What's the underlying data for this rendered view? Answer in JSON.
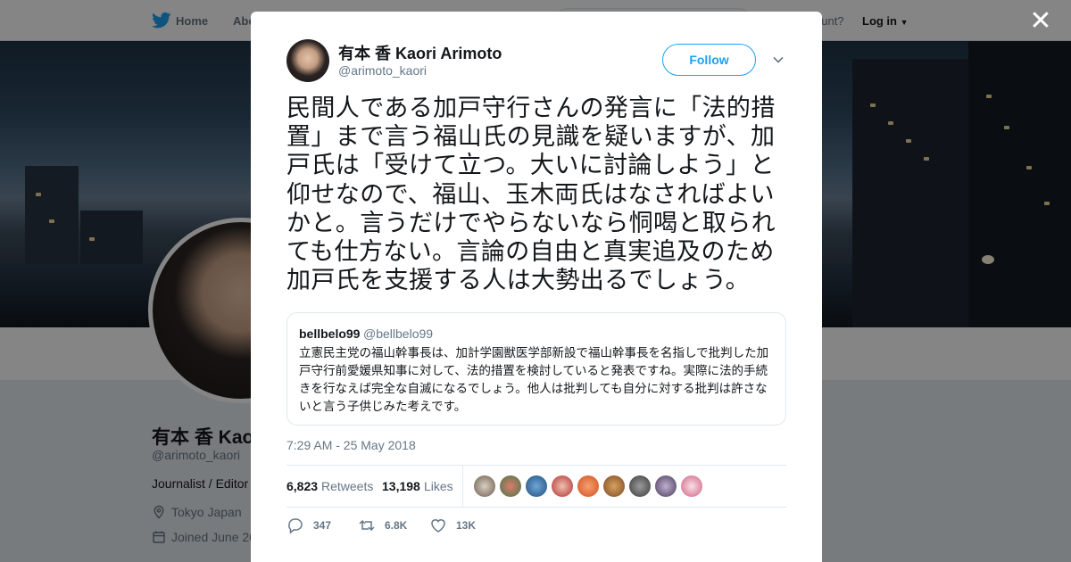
{
  "nav": {
    "home_label": "Home",
    "about_label": "Abo",
    "account_prompt": "ccount?",
    "login_label": "Log in"
  },
  "profile": {
    "name": "有本 香 Kao",
    "handle": "@arimoto_kaori",
    "bio": "Journalist / Editor",
    "location": "Tokyo Japan",
    "joined": "Joined June 20"
  },
  "tweet": {
    "author_name": "有本 香 Kaori Arimoto",
    "author_handle": "@arimoto_kaori",
    "follow_label": "Follow",
    "text": "民間人である加戸守行さんの発言に「法的措置」まで言う福山氏の見識を疑いますが、加戸氏は「受けて立つ。大いに討論しよう」と仰せなので、福山、玉木両氏はなさればよいかと。言うだけでやらないなら恫喝と取られても仕方ない。言論の自由と真実追及のため加戸氏を支援する人は大勢出るでしょう。",
    "timestamp": "7:29 AM - 25 May 2018",
    "quoted": {
      "name": "bellbelo99",
      "handle": "@bellbelo99",
      "text": "立憲民主党の福山幹事長は、加計学園獣医学部新設で福山幹事長を名指しで批判した加戸守行前愛媛県知事に対して、法的措置を検討していると発表ですね。実際に法的手続きを行なえば完全な自滅になるでしょう。他人は批判しても自分に対する批判は許さないと言う子供じみた考えです。"
    },
    "stats": {
      "retweets_count": "6,823",
      "retweets_label": "Retweets",
      "likes_count": "13,198",
      "likes_label": "Likes"
    },
    "actions": {
      "replies": "347",
      "retweets": "6.8K",
      "likes": "13K"
    }
  },
  "icons": {
    "brand": "bird-icon",
    "close": "close-icon",
    "reply": "reply-icon",
    "retweet": "retweet-icon",
    "like": "heart-icon",
    "location": "location-pin-icon",
    "calendar": "calendar-icon",
    "more": "chevron-down-icon"
  },
  "colors": {
    "accent": "#1da1f2",
    "secondary_text": "#657786",
    "border": "#e1e8ed"
  }
}
